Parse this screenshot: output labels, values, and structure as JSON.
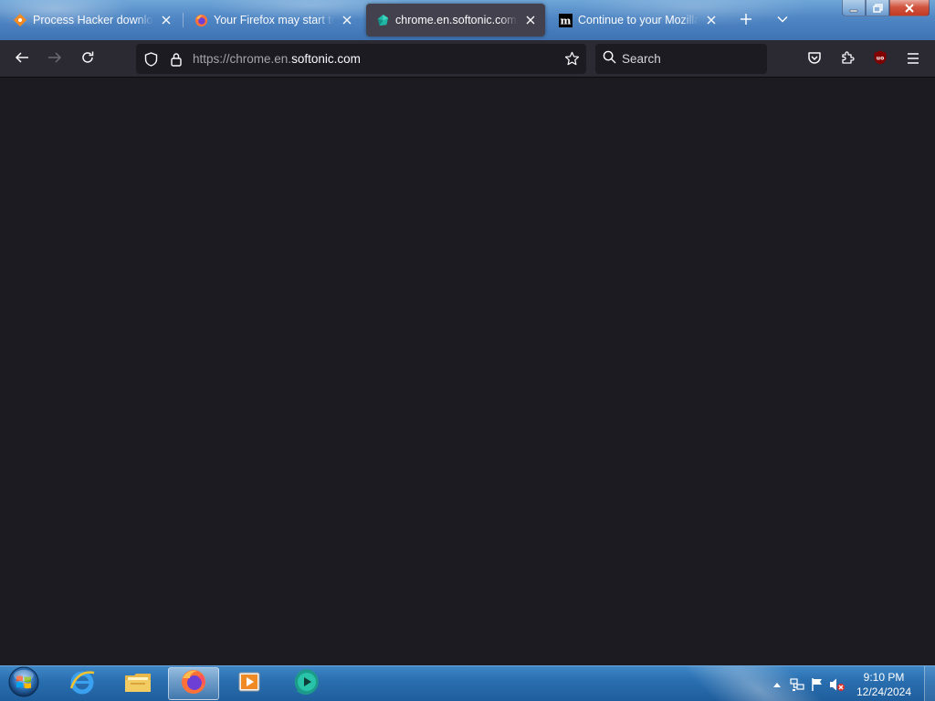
{
  "tabs": [
    {
      "title": "Process Hacker download | Soft",
      "favicon": "softonic-diamond-icon",
      "active": false
    },
    {
      "title": "Your Firefox may start to have",
      "favicon": "firefox-icon",
      "active": false
    },
    {
      "title": "chrome.en.softonic.com/",
      "favicon": "softonic-green-icon",
      "active": true
    },
    {
      "title": "Continue to your Mozilla acco",
      "favicon": "mozilla-m-icon",
      "active": false
    }
  ],
  "tabstrip": {
    "new_tab_icon": "plus-icon",
    "list_all_tabs_icon": "chevron-down-icon"
  },
  "window_controls": [
    "minimize-icon",
    "restore-icon",
    "close-icon"
  ],
  "navbar": {
    "url_prefix": "https://chrome.en.",
    "url_domain": "softonic.com",
    "search_placeholder": "Search"
  },
  "taskbar": {
    "apps": [
      "internet-explorer-icon",
      "file-explorer-icon",
      "firefox-icon",
      "media-player-icon",
      "green-app-icon"
    ],
    "active_app": "firefox-icon"
  },
  "clock": {
    "time": "9:10 PM",
    "date": "12/24/2024"
  },
  "colors": {
    "content_bg": "#1c1b22",
    "toolbar_bg": "#2b2a33",
    "active_tab_bg": "#42414d"
  }
}
